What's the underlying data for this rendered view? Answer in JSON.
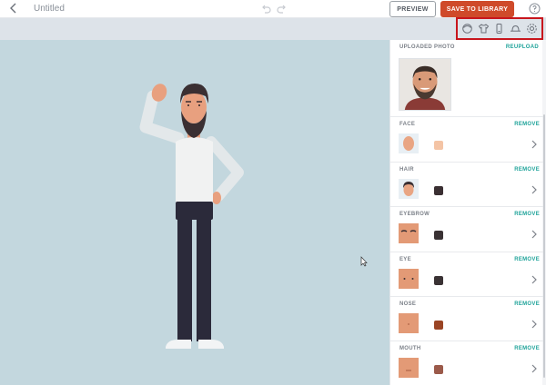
{
  "header": {
    "doc_title": "Untitled",
    "preview_label": "PREVIEW",
    "save_label": "SAVE TO LIBRARY"
  },
  "toolbar": {
    "icons": [
      "head-icon",
      "shirt-icon",
      "phone-icon",
      "hat-icon",
      "settings-icon"
    ]
  },
  "panel": {
    "photo_title": "UPLOADED PHOTO",
    "reupload_label": "REUPLOAD",
    "sections": [
      {
        "label": "FACE",
        "remove": "REMOVE",
        "color": "#f4c4a5"
      },
      {
        "label": "HAIR",
        "remove": "REMOVE",
        "color": "#3a2f32"
      },
      {
        "label": "EYEBROW",
        "remove": "REMOVE",
        "color": "#3a3234"
      },
      {
        "label": "EYE",
        "remove": "REMOVE",
        "color": "#3a3234"
      },
      {
        "label": "NOSE",
        "remove": "REMOVE",
        "color": "#9a4424"
      },
      {
        "label": "MOUTH",
        "remove": "REMOVE",
        "color": "#9b5a4a"
      }
    ]
  },
  "colors": {
    "accent": "#cf4a2a",
    "link": "#1fa39a",
    "canvas_bg": "#c3d7de",
    "highlight_box": "#c8161d"
  }
}
